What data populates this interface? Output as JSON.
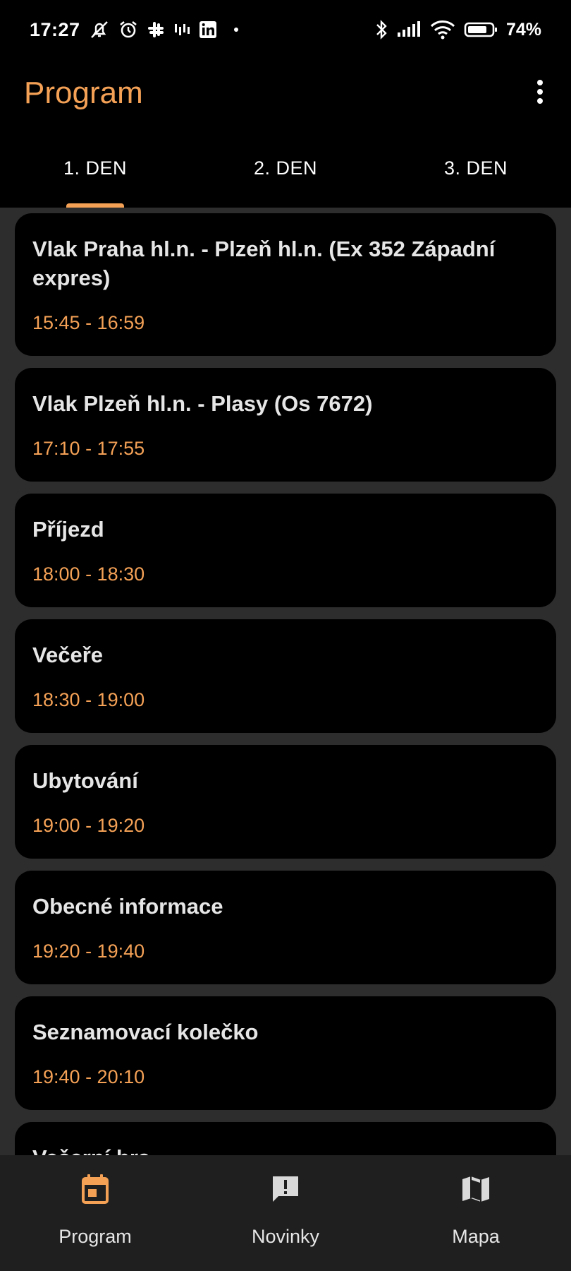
{
  "status_bar": {
    "time": "17:27",
    "battery": "74%",
    "icons": [
      "muted-bell-icon",
      "alarm-icon",
      "slack-icon",
      "voicemail-icon",
      "linkedin-icon",
      "dot-icon",
      "bluetooth-icon",
      "signal-icon",
      "wifi-icon",
      "battery-icon"
    ]
  },
  "app_bar": {
    "title": "Program",
    "menu_icon": "more-vert-icon"
  },
  "tabs": [
    {
      "label": "1. DEN",
      "active": true
    },
    {
      "label": "2. DEN",
      "active": false
    },
    {
      "label": "3. DEN",
      "active": false
    }
  ],
  "events": [
    {
      "title": "Vlak Praha hl.n. - Plzeň hl.n. (Ex 352 Západní expres)",
      "time": "15:45 - 16:59"
    },
    {
      "title": "Vlak Plzeň hl.n. - Plasy (Os 7672)",
      "time": "17:10 - 17:55"
    },
    {
      "title": "Příjezd",
      "time": "18:00 - 18:30"
    },
    {
      "title": "Večeře",
      "time": "18:30 - 19:00"
    },
    {
      "title": "Ubytování",
      "time": "19:00 - 19:20"
    },
    {
      "title": "Obecné informace",
      "time": "19:20 - 19:40"
    },
    {
      "title": "Seznamovací kolečko",
      "time": "19:40 - 20:10"
    },
    {
      "title": "Večerní hra",
      "time": ""
    }
  ],
  "bottom_nav": [
    {
      "label": "Program",
      "icon": "calendar-icon",
      "active": true
    },
    {
      "label": "Novinky",
      "icon": "announcement-icon",
      "active": false
    },
    {
      "label": "Mapa",
      "icon": "map-icon",
      "active": false
    }
  ],
  "colors": {
    "accent": "#f4a156",
    "background": "#000000",
    "list_background": "#2d2d2d",
    "card_background": "#000000",
    "nav_background": "#1f1f1f",
    "text": "#e6e6e6"
  }
}
